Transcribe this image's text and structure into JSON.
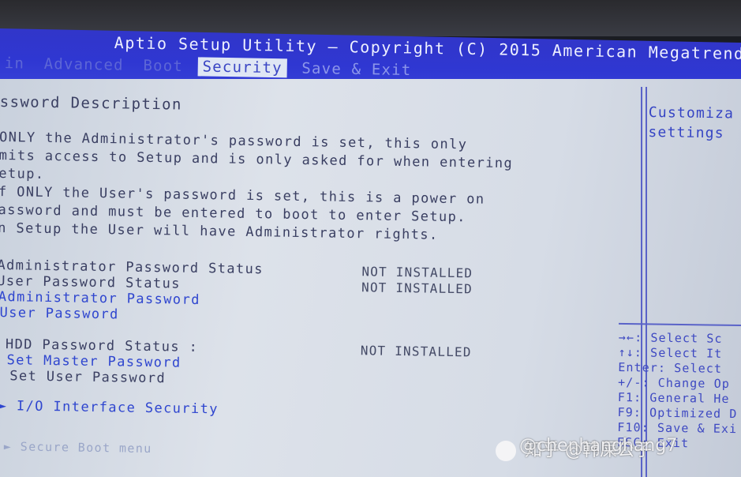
{
  "header": {
    "title": "Aptio Setup Utility – Copyright (C) 2015 American Megatrends",
    "tabs": [
      {
        "label": "in"
      },
      {
        "label": "Advanced"
      },
      {
        "label": "Boot"
      },
      {
        "label": "Security",
        "active": true
      },
      {
        "label": "Save & Exit"
      }
    ]
  },
  "main": {
    "heading": "ssword Description",
    "desc_lines": [
      "  ONLY the Administrator's password is set, this only",
      "mits access to Setup and is only asked for when entering",
      "etup.",
      "f ONLY the User's password is set, this is a power on",
      "assword and must be entered to boot to enter Setup.",
      "n Setup the User will have Administrator rights."
    ],
    "admin_status_label": "Administrator Password Status",
    "admin_status_value": "NOT INSTALLED",
    "user_status_label": "User Password Status",
    "user_status_value": "NOT INSTALLED",
    "admin_password": "Administrator Password",
    "user_password": "User Password",
    "hdd_status_label": "HDD Password Status   :",
    "hdd_status_value": "NOT INSTALLED",
    "set_master": "Set Master Password",
    "set_user": "Set User Password",
    "io_security": "I/O Interface Security",
    "secure_boot": "Secure Boot menu",
    "submenu_marker": "►"
  },
  "help": {
    "line1": "Customiza",
    "line2": "settings"
  },
  "keys": [
    "→←: Select Sc",
    "↑↓: Select It",
    "Enter: Select",
    "+/-: Change Op",
    "F1: General He",
    "F9: Optimized D",
    "F10: Save & Exi",
    "ESC: Exit"
  ],
  "watermark": {
    "text": "知乎 @韩屎公子",
    "overlay": "@chenhanghang7",
    "icon": "paw-icon"
  },
  "colors": {
    "title_bar": "#2f37d2",
    "panel": "#d6dce6",
    "selectable": "#2f46cf",
    "static_text": "#3a3f62"
  }
}
